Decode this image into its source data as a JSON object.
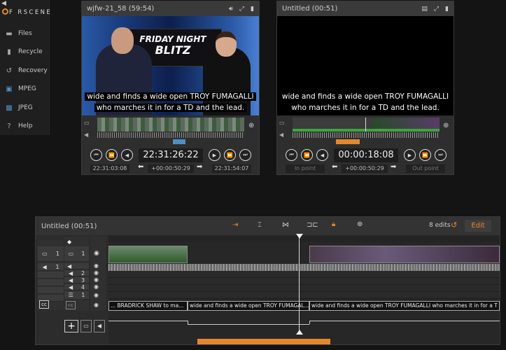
{
  "sidebar": {
    "logo": "F RSCENE",
    "items": [
      {
        "label": "Files",
        "icon": "folder-icon"
      },
      {
        "label": "Recycle",
        "icon": "trash-icon"
      },
      {
        "label": "Recovery",
        "icon": "recovery-icon"
      },
      {
        "label": "MPEG",
        "icon": "film-icon"
      },
      {
        "label": "JPEG",
        "icon": "image-icon"
      },
      {
        "label": "Help",
        "icon": "help-icon"
      }
    ]
  },
  "source": {
    "title": "wjfw-21_58 (59:54)",
    "caption_line1": "wide and finds a wide open TROY FUMAGALLI",
    "caption_line2": "who marches it in for a TD and the lead.",
    "overlay_l1": "FRIDAY NIGHT",
    "overlay_l2": "BLITZ",
    "timecode": "22:31:26:22",
    "in_tc": "22:31:03:08",
    "duration": "+00:00:50:29",
    "out_tc": "22:31:54:07"
  },
  "program": {
    "title": "Untitled (00:51)",
    "caption_line1": "wide and finds a wide open TROY FUMAGALLI",
    "caption_line2": "who marches it in for a TD and the lead.",
    "timecode": "00:00:18:08",
    "in_point": "In point",
    "duration": "+00:00:50:29",
    "out_point": "Out point"
  },
  "timeline": {
    "title": "Untitled (00:51)",
    "edits": "8 edits",
    "edit_button": "Edit",
    "video_track_num": "1",
    "audio_track_num": "1",
    "audio_tracks": [
      "2",
      "3",
      "4"
    ],
    "text_track_num": "1",
    "caption_clips": [
      "... BRADRICK SHAW to ma...",
      "wide and finds a wide open TROY FUMAGAL...",
      "wide and finds a wide open TROY FUMAGALLI who marches it in for a T"
    ],
    "cc_label": "cc"
  },
  "colors": {
    "accent": "#e8862a",
    "blue": "#4a90c8"
  }
}
